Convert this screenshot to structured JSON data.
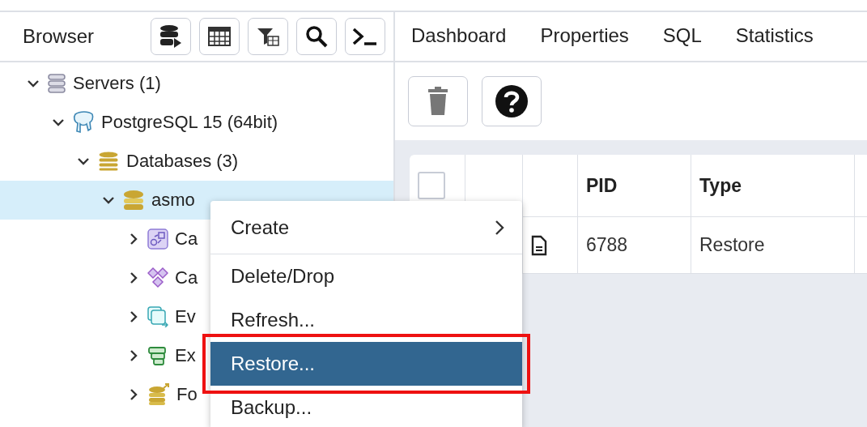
{
  "browser": {
    "title": "Browser",
    "tools": [
      {
        "kind": "query-tool"
      },
      {
        "kind": "view-data"
      },
      {
        "kind": "filtered-rows"
      },
      {
        "kind": "search"
      },
      {
        "kind": "psql"
      }
    ]
  },
  "tree": [
    {
      "label": "Servers (1)",
      "kind": "servers",
      "expanded": true,
      "selected": false,
      "children": [
        {
          "label": "PostgreSQL 15 (64bit)",
          "kind": "server",
          "expanded": true,
          "selected": false,
          "children": [
            {
              "label": "Databases (3)",
              "kind": "databases",
              "expanded": true,
              "selected": false,
              "children": [
                {
                  "label": "asmo",
                  "kind": "database",
                  "expanded": true,
                  "selected": true,
                  "children": [
                    {
                      "label": "Ca",
                      "kind": "casts",
                      "expanded": false,
                      "selected": false
                    },
                    {
                      "label": "Ca",
                      "kind": "catalogs",
                      "expanded": false,
                      "selected": false
                    },
                    {
                      "label": "Ev",
                      "kind": "event-triggers",
                      "expanded": false,
                      "selected": false
                    },
                    {
                      "label": "Ex",
                      "kind": "extensions",
                      "expanded": false,
                      "selected": false
                    },
                    {
                      "label": "Fo",
                      "kind": "foreign-data",
                      "expanded": false,
                      "selected": false
                    }
                  ]
                }
              ]
            }
          ]
        }
      ]
    }
  ],
  "context_menu": {
    "items": [
      {
        "label": "Create",
        "submenu": true,
        "selected": false,
        "outlined": false
      },
      {
        "label": "Delete/Drop",
        "submenu": false,
        "selected": false,
        "outlined": false
      },
      {
        "label": "Refresh...",
        "submenu": false,
        "selected": false,
        "outlined": false
      },
      {
        "label": "Restore...",
        "submenu": false,
        "selected": true,
        "outlined": true
      },
      {
        "label": "Backup...",
        "submenu": false,
        "selected": false,
        "outlined": false
      }
    ]
  },
  "tabs": [
    {
      "label": "Dashboard",
      "selected": false
    },
    {
      "label": "Properties",
      "selected": false
    },
    {
      "label": "SQL",
      "selected": false
    },
    {
      "label": "Statistics",
      "selected": false
    }
  ],
  "toolbar": [
    {
      "kind": "delete",
      "disabled": true
    },
    {
      "kind": "help",
      "disabled": false
    }
  ],
  "table": {
    "all_checked": false,
    "columns": [
      "",
      "",
      "",
      "PID",
      "Type"
    ],
    "rows": [
      {
        "has_log": true,
        "cells": [
          "6788",
          "Restore"
        ]
      }
    ]
  }
}
